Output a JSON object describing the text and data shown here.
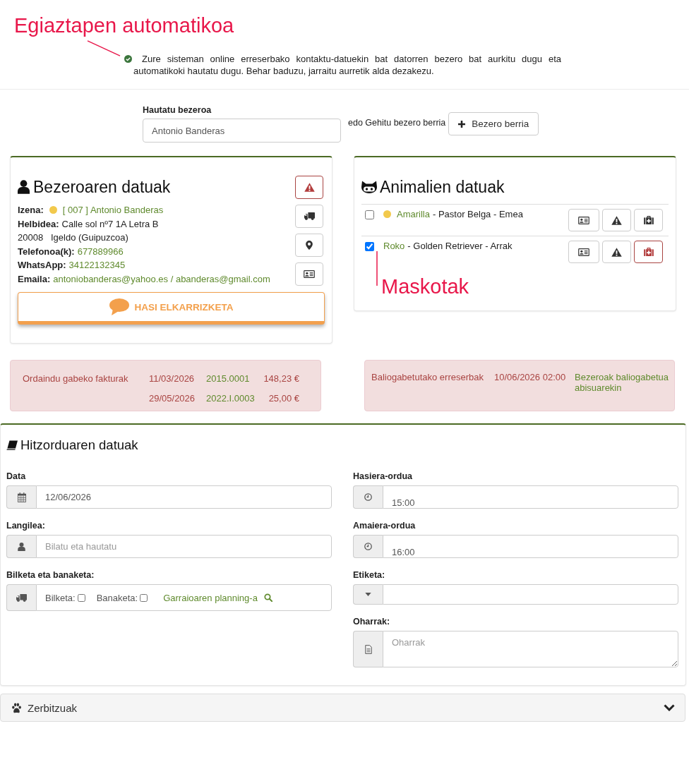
{
  "notice": {
    "annotation": "Egiaztapen automatikoa",
    "text": "Zure sisteman online erreserbako kontaktu-datuekin bat datorren bezero bat aurkitu dugu eta automatikoki hautatu dugu. Behar baduzu, jarraitu aurretik alda dezakezu."
  },
  "client_select": {
    "label": "Hautatu bezeroa",
    "value": "Antonio Banderas",
    "or_text": "edo Gehitu bezero berria",
    "new_button": "Bezero berria"
  },
  "client_card": {
    "title": "Bezeroaren datuak",
    "fields": [
      {
        "kind": "link",
        "label": "Izena:",
        "value": "[ 007 ] Antonio Banderas",
        "color": "#f2c94c"
      },
      {
        "kind": "text",
        "label": "Helbidea:",
        "value": "Calle sol nº7 1A Letra B"
      },
      {
        "kind": "text",
        "value": "20008   Igeldo (Guipuzcoa)"
      },
      {
        "kind": "link",
        "label": "Telefonoa(k):",
        "value": "677889966"
      },
      {
        "kind": "link",
        "label": "WhatsApp:",
        "value": "34122132345"
      },
      {
        "kind": "link",
        "label": "Emaila:",
        "value": "antoniobanderas@yahoo.es / abanderas@gmail.com"
      }
    ],
    "actions": [
      {
        "kind": "warning",
        "alert": true
      },
      {
        "kind": "truck",
        "alert": false
      },
      {
        "kind": "location",
        "alert": false
      },
      {
        "kind": "card",
        "alert": false
      }
    ],
    "chat_button": "HASI ELKARRIZKETA"
  },
  "pets_card": {
    "title": "Animalien datuak",
    "annotation": "Maskotak",
    "pets": [
      {
        "name": "Amarilla",
        "details": "- Pastor Belga - Emea",
        "checked": false,
        "color": "#f2c94c",
        "actions": [
          {
            "kind": "card",
            "alert": false
          },
          {
            "kind": "warning",
            "alert": false
          },
          {
            "kind": "medkit",
            "alert": false
          }
        ]
      },
      {
        "name": "Roko",
        "details": "- Golden Retriever - Arrak",
        "checked": true,
        "actions": [
          {
            "kind": "card",
            "alert": false
          },
          {
            "kind": "warning",
            "alert": false
          },
          {
            "kind": "medkit",
            "alert": true
          }
        ]
      }
    ]
  },
  "alerts": [
    {
      "kind": "invoices",
      "title": "Ordaindu gabeko fakturak",
      "rows": [
        {
          "date": "11/03/2026",
          "reference": "2015.0001",
          "amount": "148,23 €"
        },
        {
          "date": "29/05/2026",
          "reference": "2022.I.0003",
          "amount": "25,00 €"
        }
      ]
    },
    {
      "kind": "cancellations",
      "title": "Baliogabetutako erreserbak",
      "rows": [
        {
          "date": "10/06/2026 02:00",
          "note": "Bezeroak baliogabetua abisuarekin"
        }
      ]
    }
  ],
  "appointment": {
    "title": "Hitzorduaren datuak",
    "columns": [
      [
        {
          "kind": "date",
          "label": "Data",
          "value": "12/06/2026"
        },
        {
          "kind": "staff",
          "label": "Langilea:",
          "placeholder": "Bilatu eta hautatu"
        },
        {
          "kind": "transport",
          "label": "Bilketa eta banaketa:",
          "options": [
            {
              "label": "Bilketa:",
              "checked": false
            },
            {
              "label": "Banaketa:",
              "checked": false
            }
          ],
          "link": "Garraioaren planning-a"
        }
      ],
      [
        {
          "kind": "time",
          "label": "Hasiera-ordua",
          "value": "15:00"
        },
        {
          "kind": "time",
          "label": "Amaiera-ordua",
          "value": "16:00"
        },
        {
          "kind": "tag",
          "label": "Etiketa:"
        },
        {
          "kind": "notes",
          "label": "Oharrak:",
          "placeholder": "Oharrak"
        }
      ]
    ]
  },
  "services": {
    "title": "Zerbitzuak",
    "expanded": false
  }
}
